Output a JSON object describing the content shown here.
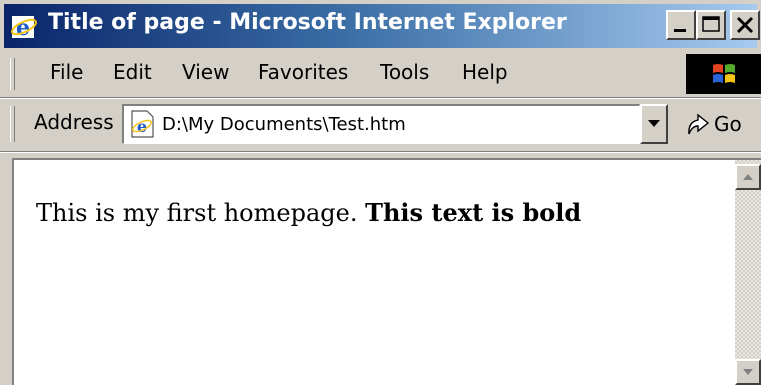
{
  "window": {
    "title": "Title of page - Microsoft Internet Explorer"
  },
  "menu": {
    "items": [
      "File",
      "Edit",
      "View",
      "Favorites",
      "Tools",
      "Help"
    ]
  },
  "address": {
    "label": "Address",
    "value": "D:\\My Documents\\Test.htm",
    "go_label": "Go"
  },
  "page": {
    "text": "This is my first homepage.",
    "bold_text": "This text is bold"
  },
  "colors": {
    "titlebar_start": "#0a246a",
    "titlebar_end": "#a6caf0",
    "chrome": "#d4d0c8",
    "content_bg": "#ffffff"
  },
  "icons": [
    "ie-icon",
    "minimize-icon",
    "maximize-icon",
    "close-icon",
    "windows-logo-icon",
    "page-icon",
    "dropdown-arrow-icon",
    "go-arrow-icon",
    "scroll-up-arrow-icon",
    "scroll-down-arrow-icon"
  ]
}
